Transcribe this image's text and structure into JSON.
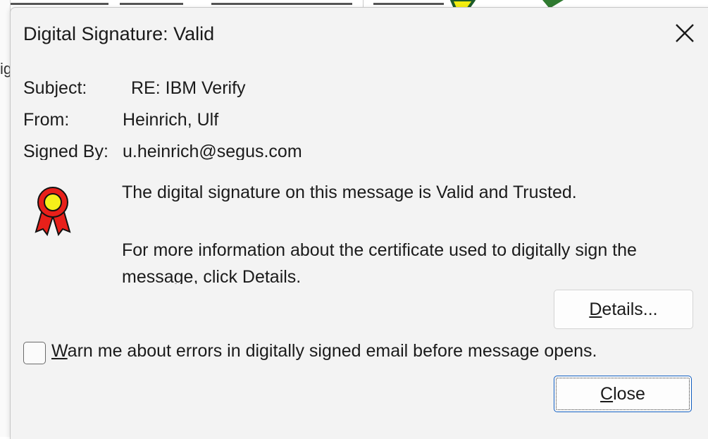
{
  "background": {
    "fragment_text": "ig"
  },
  "dialog": {
    "title": "Digital Signature: Valid",
    "fields": {
      "subject_label": "Subject:",
      "subject_value": "RE: IBM Verify",
      "from_label": "From:",
      "from_value": "Heinrich, Ulf",
      "signed_by_label": "Signed By:",
      "signed_by_value": "u.heinrich@segus.com"
    },
    "message_valid": "The digital signature on this message is Valid and Trusted.",
    "message_info": "For more information about the certificate used to digitally sign the message, click Details.",
    "details_button": {
      "prefix": "",
      "accel": "D",
      "rest": "etails..."
    },
    "warn_checkbox": {
      "accel": "W",
      "rest": "arn me about errors in digitally signed email before message opens.",
      "checked": false
    },
    "close_button": {
      "accel": "C",
      "rest": "lose"
    },
    "icons": {
      "close": "close-icon",
      "certificate": "award-ribbon-icon"
    },
    "colors": {
      "dialog_bg": "#f3f3f3",
      "focus_border": "#0f5cbf",
      "ribbon_red": "#e8201a",
      "ribbon_yellow": "#f6ef1a"
    }
  }
}
